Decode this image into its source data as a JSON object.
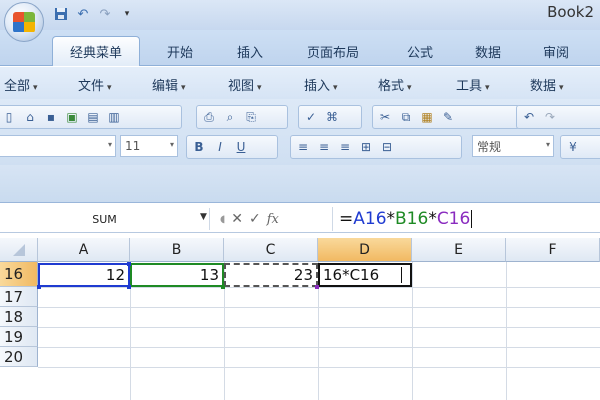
{
  "app": {
    "title": "Book2"
  },
  "quick_access": {
    "icons": [
      "save-icon",
      "undo-icon",
      "redo-icon",
      "customize-icon"
    ]
  },
  "ribbon": {
    "tabs": [
      "经典菜单",
      "开始",
      "插入",
      "页面布局",
      "公式",
      "数据",
      "审阅"
    ],
    "active_tab": "经典菜单"
  },
  "menubar": {
    "items": [
      "全部",
      "文件",
      "编辑",
      "视图",
      "插入",
      "格式",
      "工具",
      "数据"
    ]
  },
  "toolbar": {
    "font_size": "11",
    "bold": "B",
    "italic": "I",
    "underline": "U",
    "number_format": "常规"
  },
  "formula_bar": {
    "name_box": "SUM",
    "cancel": "✕",
    "enter": "✓",
    "fx": "fx",
    "formula": {
      "eq": "=",
      "ref1": "A16",
      "op1": "*",
      "ref2": "B16",
      "op2": "*",
      "ref3": "C16"
    }
  },
  "sheet": {
    "columns": [
      "A",
      "B",
      "C",
      "D",
      "E",
      "F"
    ],
    "rows": [
      "16",
      "17",
      "18",
      "19",
      "20"
    ],
    "selected_column": "D",
    "selected_row": "16",
    "cells": {
      "A16": "12",
      "B16": "13",
      "C16": "23",
      "D16": "16*C16"
    }
  },
  "colors": {
    "ref_a": "#1f3bd1",
    "ref_b": "#1e8a24",
    "ref_c": "#8a2bbf",
    "accent": "#f1b962",
    "ribbon": "#cddff4"
  }
}
